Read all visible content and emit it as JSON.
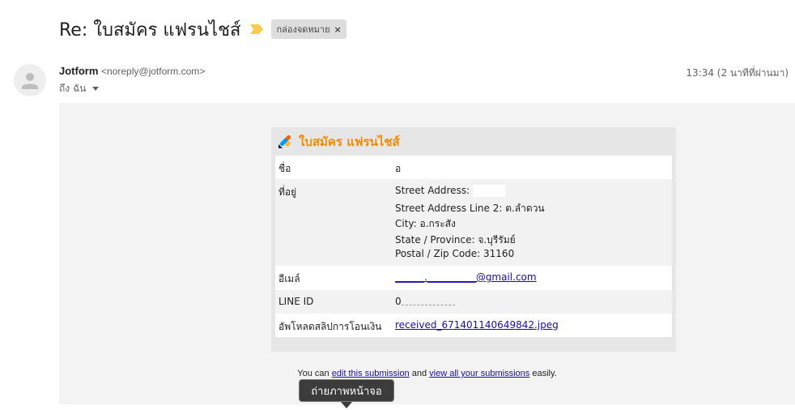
{
  "header": {
    "subject": "Re: ใบสมัคร แฟรนไชส์",
    "label": "กล่องจดหมาย",
    "label_remove": "×"
  },
  "message": {
    "sender_name": "Jotform",
    "sender_email": "<noreply@jotform.com>",
    "recipient": "ถึง ฉัน",
    "timestamp": "13:34 (2 นาทีที่ผ่านมา)"
  },
  "form": {
    "title": "ใบสมัคร แฟรนไชส์",
    "rows": [
      {
        "label": "ชื่อ",
        "lines": [
          "อ"
        ]
      },
      {
        "label": "ที่อยู่",
        "lines": [
          "Street Address:",
          "Street Address Line 2: ต.ลำดวน",
          "City: อ.กระสัง",
          "State / Province: จ.บุรีรัมย์",
          "Postal / Zip Code: 31160"
        ]
      },
      {
        "label": "อีเมล์",
        "lines": [
          "______.__________@gmail.com"
        ]
      },
      {
        "label": "LINE ID",
        "lines": [
          "0"
        ]
      },
      {
        "label": "อัพโหลดสลิปการโอนเงิน",
        "lines": [
          "received_671401140649842.jpeg"
        ]
      }
    ]
  },
  "footer": {
    "prefix": "You can",
    "edit_link": "edit this submission",
    "middle": "and",
    "view_link": "view all your submissions",
    "suffix": "easily."
  },
  "tooltip": {
    "text": "ถ่ายภาพหน้าจอ"
  },
  "colors": {
    "accent": "#f08c00",
    "link": "#1a0dab",
    "importance": "#f7cb4d"
  }
}
